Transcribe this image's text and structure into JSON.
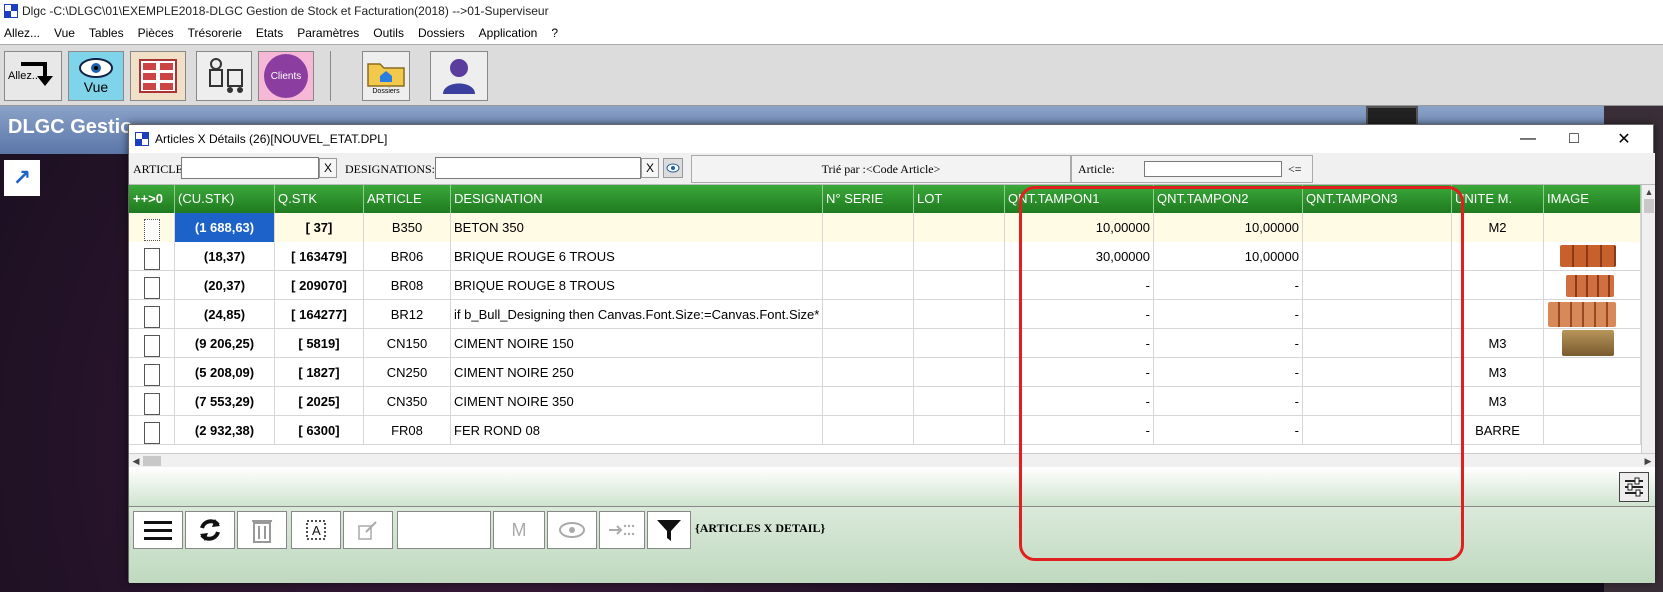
{
  "app": {
    "title": "Dlgc -C:\\DLGC\\01\\EXEMPLE2018-DLGC Gestion de Stock et Facturation(2018) -->01-Superviseur",
    "menu": [
      "Allez...",
      "Vue",
      "Tables",
      "Pièces",
      "Trésorerie",
      "Etats",
      "Paramètres",
      "Outils",
      "Dossiers",
      "Application",
      "?"
    ]
  },
  "toolbar": {
    "allez_label": "Allez...",
    "vue_label": "Vue",
    "clients_label": "Clients",
    "dossiers_label": "Dossiers"
  },
  "background": {
    "header_title": "DLGC Gestio"
  },
  "dialog": {
    "title": "Articles X Détails (26)[NOUVEL_ETAT.DPL]",
    "filters": {
      "article_label": "ARTICLE:",
      "article_value": "",
      "designations_label": "DESIGNATIONS:",
      "designations_value": "",
      "clear_label": "X",
      "sort_label": "Trié par :<Code Article>",
      "article2_label": "Article:",
      "article2_value": "",
      "article2_arrow": "<="
    },
    "columns": [
      "++>0",
      "(CU.STK)",
      "Q.STK",
      "ARTICLE",
      "DESIGNATION",
      "N° SERIE",
      "LOT",
      "QNT.TAMPON1",
      "QNT.TAMPON2",
      "QNT.TAMPON3",
      "UNITE M.",
      "IMAGE"
    ],
    "rows": [
      {
        "cu": "(1 688,63)",
        "q": "[ 37]",
        "article": "B350",
        "designation": "BETON 350",
        "serie": "",
        "lot": "",
        "t1": "10,00000",
        "t2": "10,00000",
        "t3": "",
        "unite": "M2",
        "image": ""
      },
      {
        "cu": "(18,37)",
        "q": "[ 163479]",
        "article": "BR06",
        "designation": "BRIQUE ROUGE 6 TROUS",
        "serie": "",
        "lot": "",
        "t1": "30,00000",
        "t2": "10,00000",
        "t3": "",
        "unite": "",
        "image": "brick-6"
      },
      {
        "cu": "(20,37)",
        "q": "[ 209070]",
        "article": "BR08",
        "designation": "BRIQUE ROUGE 8 TROUS",
        "serie": "",
        "lot": "",
        "t1": "-",
        "t2": "-",
        "t3": "",
        "unite": "",
        "image": "brick-8"
      },
      {
        "cu": "(24,85)",
        "q": "[ 164277]",
        "article": "BR12",
        "designation": "if b_Bull_Designing then  Canvas.Font.Size:=Canvas.Font.Size*",
        "serie": "",
        "lot": "",
        "t1": "-",
        "t2": "-",
        "t3": "",
        "unite": "",
        "image": "brick-12"
      },
      {
        "cu": "(9 206,25)",
        "q": "[ 5819]",
        "article": "CN150",
        "designation": "CIMENT NOIRE 150",
        "serie": "",
        "lot": "",
        "t1": "-",
        "t2": "-",
        "t3": "",
        "unite": "M3",
        "image": "cement-bag"
      },
      {
        "cu": "(5 208,09)",
        "q": "[ 1827]",
        "article": "CN250",
        "designation": "CIMENT NOIRE 250",
        "serie": "",
        "lot": "",
        "t1": "-",
        "t2": "-",
        "t3": "",
        "unite": "M3",
        "image": ""
      },
      {
        "cu": "(7 553,29)",
        "q": "[ 2025]",
        "article": "CN350",
        "designation": "CIMENT NOIRE 350",
        "serie": "",
        "lot": "",
        "t1": "-",
        "t2": "-",
        "t3": "",
        "unite": "M3",
        "image": ""
      },
      {
        "cu": "(2 932,38)",
        "q": "[ 6300]",
        "article": "FR08",
        "designation": "FER ROND 08",
        "serie": "",
        "lot": "",
        "t1": "-",
        "t2": "-",
        "t3": "",
        "unite": "BARRE",
        "image": ""
      }
    ],
    "dash": "-",
    "bottom": {
      "m_label": "M",
      "status": "{ARTICLES X DETAIL}"
    }
  },
  "colors": {
    "header_green": "#2e9a2e",
    "selection_blue": "#1d62c9",
    "annotation_red": "#e02020"
  }
}
